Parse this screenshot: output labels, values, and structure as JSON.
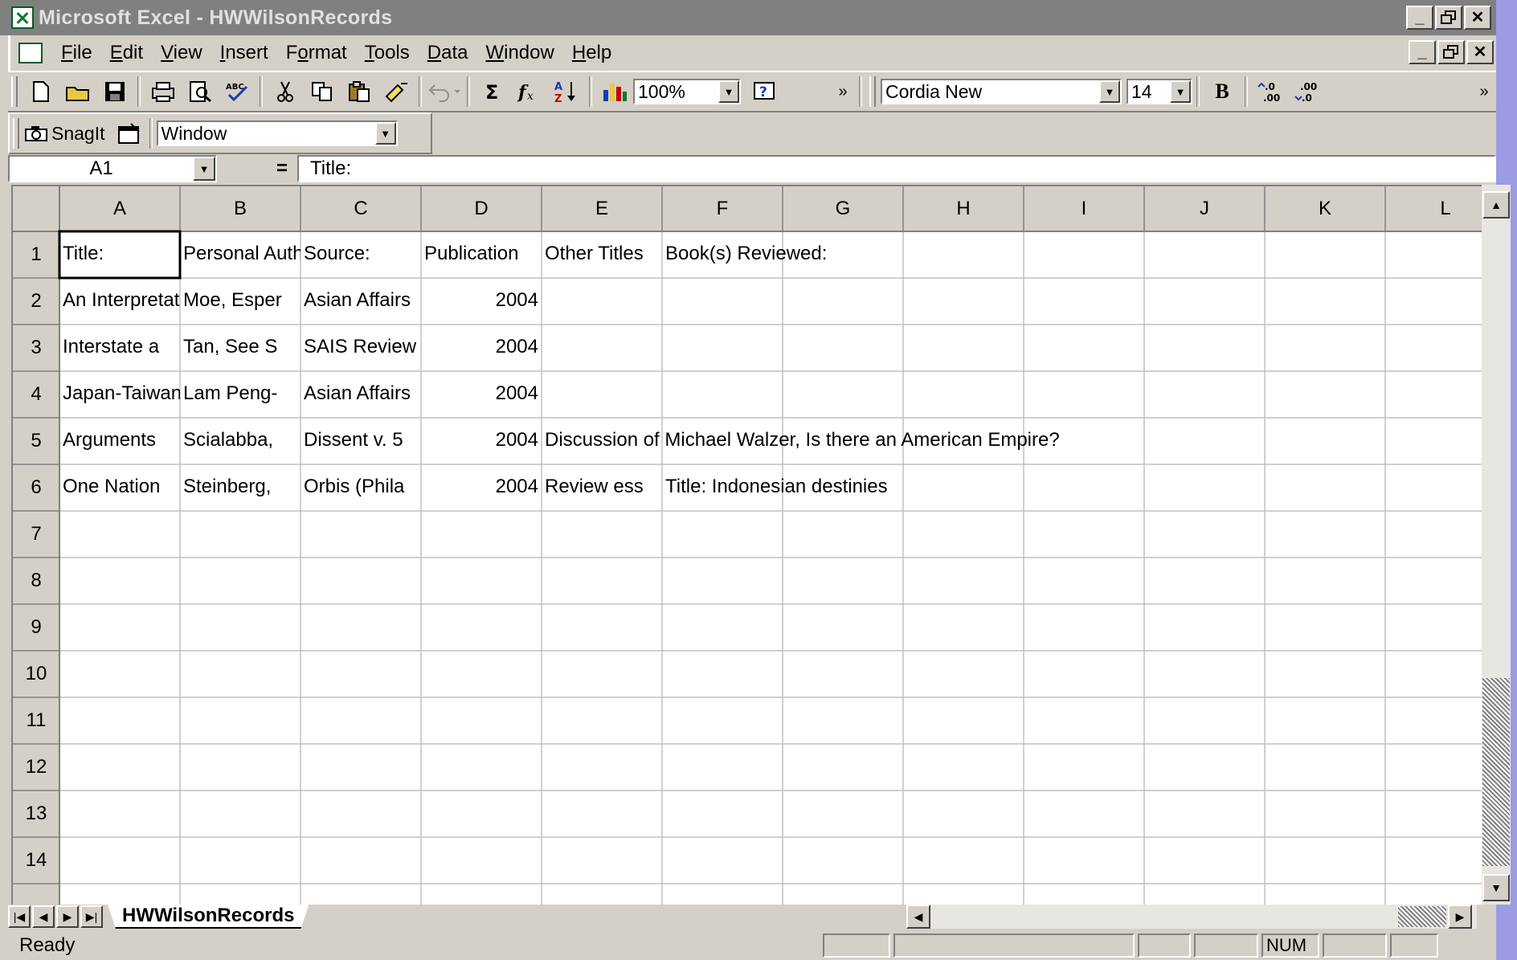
{
  "window": {
    "title": "Microsoft Excel - HWWilsonRecords",
    "minimize": "_",
    "restore": "🗗",
    "close": "✕"
  },
  "menu": {
    "items": [
      {
        "key": "F",
        "rest": "ile"
      },
      {
        "key": "E",
        "rest": "dit"
      },
      {
        "key": "V",
        "rest": "iew",
        "pre": ""
      },
      {
        "key": "I",
        "rest": "nsert"
      },
      {
        "pre": "F",
        "key": "o",
        "rest": "rmat"
      },
      {
        "key": "T",
        "rest": "ools"
      },
      {
        "key": "D",
        "rest": "ata"
      },
      {
        "key": "W",
        "rest": "indow"
      },
      {
        "key": "H",
        "rest": "elp"
      }
    ]
  },
  "toolbar": {
    "zoom": "100%",
    "font_name": "Cordia New",
    "font_size": "14",
    "bold": "B",
    "icons": [
      "new-icon",
      "open-icon",
      "save-icon",
      "print-icon",
      "print-preview-icon",
      "spelling-icon",
      "cut-icon",
      "copy-icon",
      "paste-icon",
      "format-painter-icon",
      "undo-icon",
      "autosum-icon",
      "function-icon",
      "sort-ascending-icon",
      "chart-wizard-icon",
      "help-icon",
      "increase-decimal-icon",
      "decrease-decimal-icon"
    ]
  },
  "snagit": {
    "label": "SnagIt",
    "capture_mode": "Window"
  },
  "formula_bar": {
    "name_box": "A1",
    "equals": "=",
    "content": "Title:"
  },
  "grid": {
    "columns": [
      "A",
      "B",
      "C",
      "D",
      "E",
      "F",
      "G",
      "H",
      "I",
      "J",
      "K",
      "L"
    ],
    "rows": [
      "1",
      "2",
      "3",
      "4",
      "5",
      "6",
      "7",
      "8",
      "9",
      "10",
      "11",
      "12",
      "13",
      "14"
    ],
    "cells": [
      {
        "r": 1,
        "c": "A",
        "v": "Title:"
      },
      {
        "r": 1,
        "c": "B",
        "v": "Personal Author:"
      },
      {
        "r": 1,
        "c": "C",
        "v": "Source:"
      },
      {
        "r": 1,
        "c": "D",
        "v": "Publication"
      },
      {
        "r": 1,
        "c": "E",
        "v": "Other Titles"
      },
      {
        "r": 1,
        "c": "F",
        "v": "Book(s) Reviewed:"
      },
      {
        "r": 2,
        "c": "A",
        "v": "An Interpretation"
      },
      {
        "r": 2,
        "c": "B",
        "v": "Moe, Esper"
      },
      {
        "r": 2,
        "c": "C",
        "v": "Asian Affairs"
      },
      {
        "r": 2,
        "c": "D",
        "v": "2004",
        "num": true
      },
      {
        "r": 3,
        "c": "A",
        "v": "Interstate a"
      },
      {
        "r": 3,
        "c": "B",
        "v": "Tan, See S"
      },
      {
        "r": 3,
        "c": "C",
        "v": "SAIS Review"
      },
      {
        "r": 3,
        "c": "D",
        "v": "2004",
        "num": true
      },
      {
        "r": 4,
        "c": "A",
        "v": "Japan-Taiwan"
      },
      {
        "r": 4,
        "c": "B",
        "v": "Lam Peng-"
      },
      {
        "r": 4,
        "c": "C",
        "v": "Asian Affairs"
      },
      {
        "r": 4,
        "c": "D",
        "v": "2004",
        "num": true
      },
      {
        "r": 5,
        "c": "A",
        "v": "Arguments"
      },
      {
        "r": 5,
        "c": "B",
        "v": "Scialabba,"
      },
      {
        "r": 5,
        "c": "C",
        "v": "Dissent v. 5"
      },
      {
        "r": 5,
        "c": "D",
        "v": "2004",
        "num": true
      },
      {
        "r": 5,
        "c": "E",
        "v": "Discussion of Michael Walzer, Is there an American Empire?"
      },
      {
        "r": 6,
        "c": "A",
        "v": "One Nation"
      },
      {
        "r": 6,
        "c": "B",
        "v": "Steinberg,"
      },
      {
        "r": 6,
        "c": "C",
        "v": "Orbis (Phila"
      },
      {
        "r": 6,
        "c": "D",
        "v": "2004",
        "num": true
      },
      {
        "r": 6,
        "c": "E",
        "v": "Review ess"
      },
      {
        "r": 6,
        "c": "F",
        "v": "Title: Indonesian destinies"
      }
    ]
  },
  "sheet_tab": "HWWilsonRecords",
  "status": {
    "text": "Ready",
    "num": "NUM"
  }
}
